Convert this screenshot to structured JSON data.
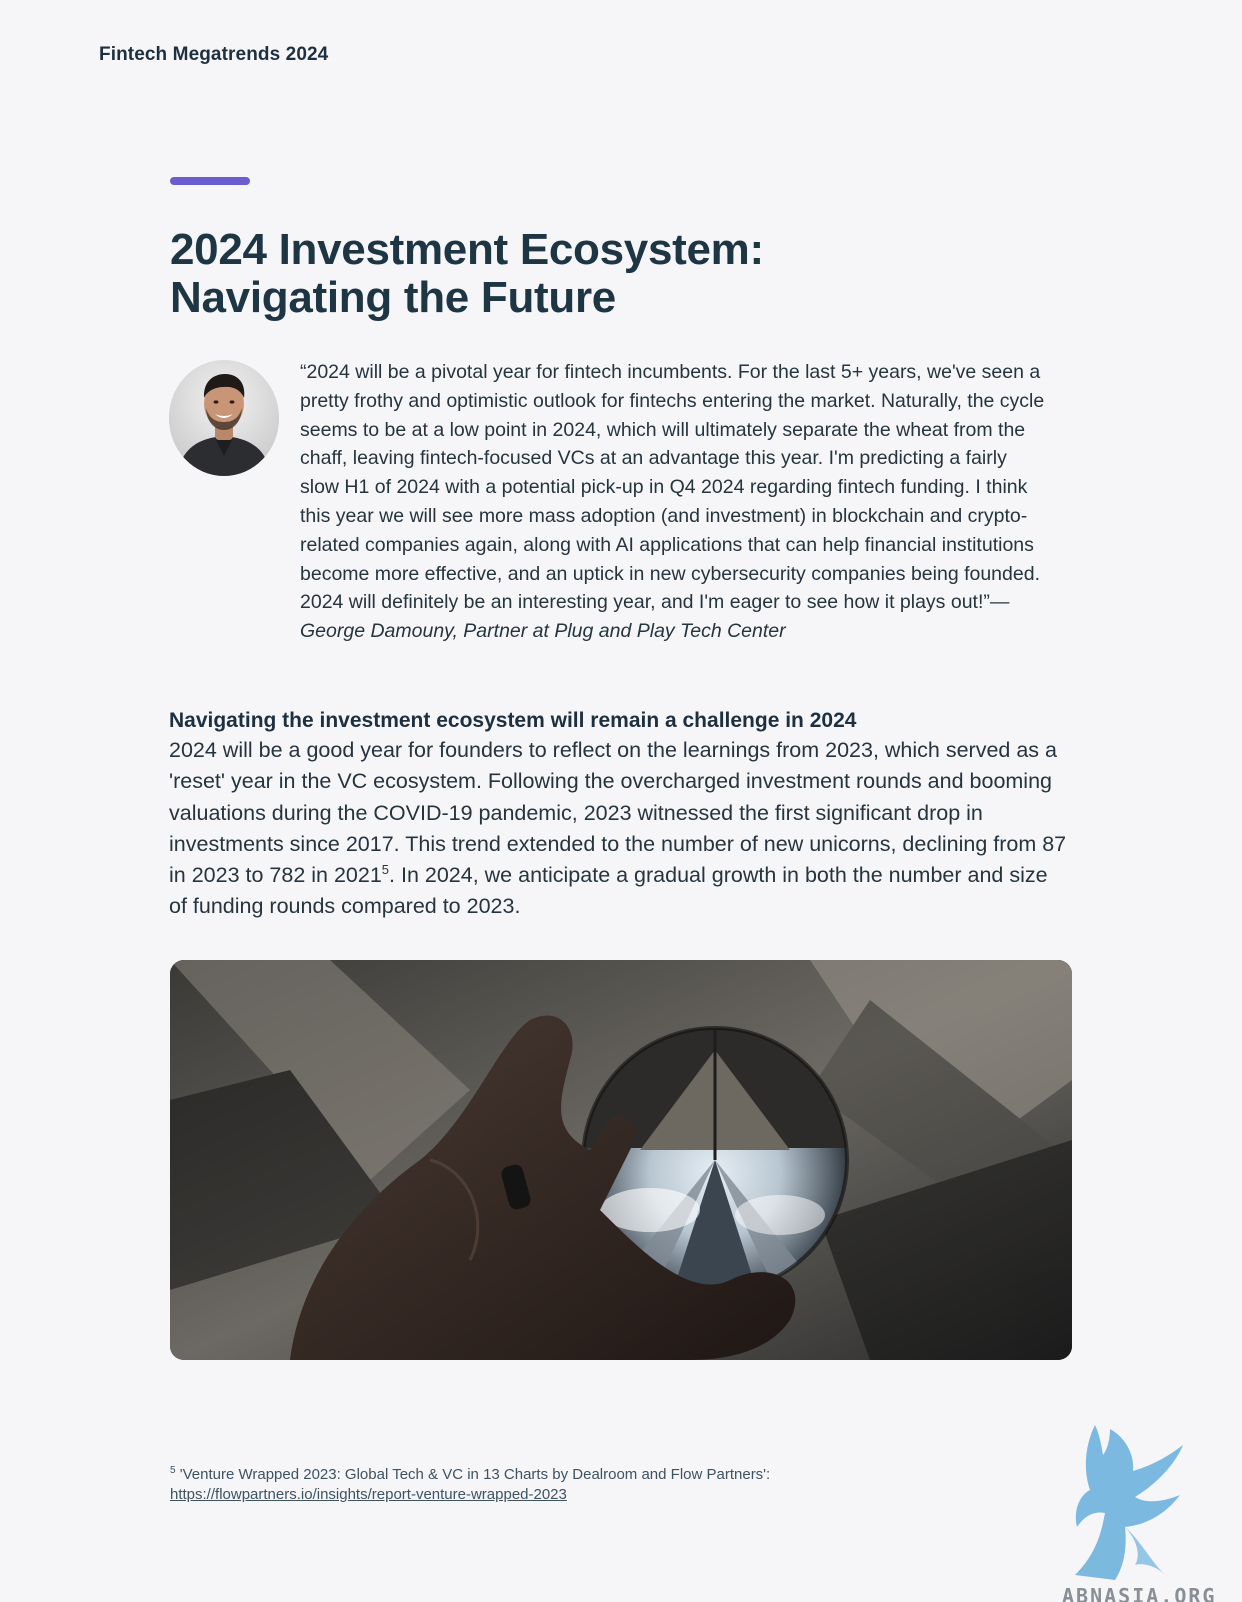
{
  "header": {
    "running_title": "Fintech Megatrends 2024"
  },
  "article": {
    "title_line1": "2024 Investment Ecosystem:",
    "title_line2": "Navigating the Future",
    "accent_color": "#6b5ccf"
  },
  "quote": {
    "text": "“2024 will be a pivotal year for fintech incumbents. For the last 5+ years, we've seen a pretty frothy and optimistic outlook for fintechs entering the market. Naturally, the cycle seems to be at a low point in 2024, which will ultimately separate the wheat from the chaff, leaving fintech-focused VCs at an advantage this year. I'm predicting a fairly slow H1 of 2024 with a potential pick-up in Q4 2024 regarding fintech funding. I think this year we will see more mass adoption (and investment) in blockchain and crypto-related companies again, along with AI applications that can help financial institutions become more effective, and an uptick in new cybersecurity companies being founded. 2024 will definitely be an interesting year, and I'm eager to see how it plays out!”",
    "attribution": "—George Damouny, Partner at Plug and Play Tech Center",
    "avatar_icon": "portrait-photo-icon"
  },
  "section": {
    "heading": "Navigating the investment ecosystem will remain a challenge in 2024",
    "body_part1": "2024 will be a good year for founders to reflect on the learnings from 2023, which served as a 'reset' year in the VC ecosystem. Following the overcharged investment rounds and booming valuations during the COVID-19 pandemic, 2023 witnessed the first significant drop in investments since 2017. This trend extended to the number of new unicorns, declining from 87 in 2023 to 782 in 2021",
    "footnote_ref": "5",
    "body_part2": ". In 2024, we anticipate a gradual growth in both the number and size of funding rounds compared to 2023."
  },
  "image": {
    "icon": "crystal-ball-photo-icon"
  },
  "footnote": {
    "number": "5",
    "text": " 'Venture Wrapped 2023: Global Tech & VC in 13 Charts by Dealroom and Flow Partners':",
    "link": "https://flowpartners.io/insights/report-venture-wrapped-2023"
  },
  "watermark": {
    "icon": "griffin-logo-icon",
    "text": "ABNASIA.ORG",
    "color": "#6fb3dd"
  }
}
